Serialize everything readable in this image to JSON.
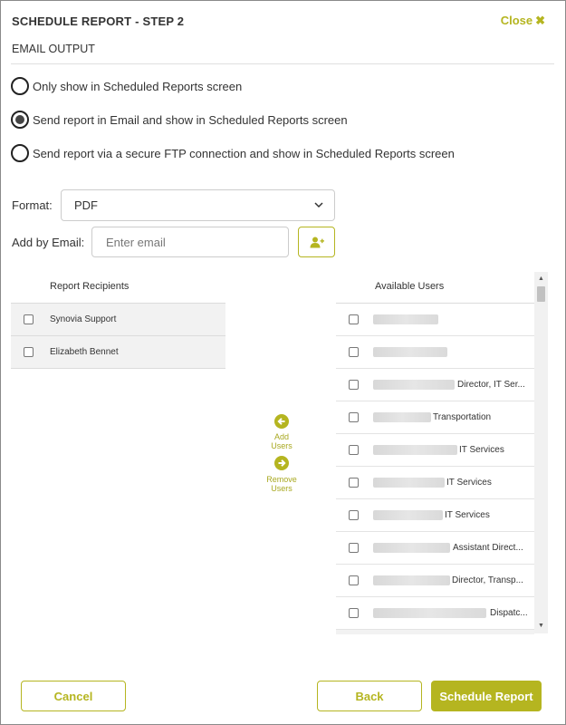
{
  "dialog": {
    "title": "SCHEDULE REPORT - STEP 2",
    "close_label": "Close",
    "subtitle": "EMAIL OUTPUT"
  },
  "output_options": [
    {
      "label": "Only show in Scheduled Reports screen",
      "selected": false
    },
    {
      "label": "Send report in Email and show in Scheduled Reports screen",
      "selected": true
    },
    {
      "label": "Send report via a secure FTP connection and show in Scheduled Reports screen",
      "selected": false
    }
  ],
  "format": {
    "label": "Format:",
    "value": "PDF"
  },
  "add_email": {
    "label": "Add by Email:",
    "placeholder": "Enter email"
  },
  "recipients": {
    "header": "Report Recipients",
    "items": [
      "Synovia Support",
      "Elizabeth Bennet"
    ]
  },
  "actions": {
    "add_users": [
      "Add",
      "Users"
    ],
    "remove_users": [
      "Remove",
      "Users"
    ]
  },
  "available_users": {
    "header": "Available Users",
    "items": [
      {
        "title": ""
      },
      {
        "title": ""
      },
      {
        "title": "Director, IT Ser..."
      },
      {
        "title": "Transportation"
      },
      {
        "title": "IT Services"
      },
      {
        "title": "IT Services"
      },
      {
        "title": "IT Services"
      },
      {
        "title": "Assistant Direct..."
      },
      {
        "title": "Director, Transp..."
      },
      {
        "title": "Dispatc..."
      }
    ]
  },
  "footer": {
    "cancel_label": "Cancel",
    "back_label": "Back",
    "schedule_label": "Schedule Report"
  },
  "colors": {
    "accent": "#b5b520",
    "row_alt": "#f2f2f2",
    "text": "#333333"
  }
}
